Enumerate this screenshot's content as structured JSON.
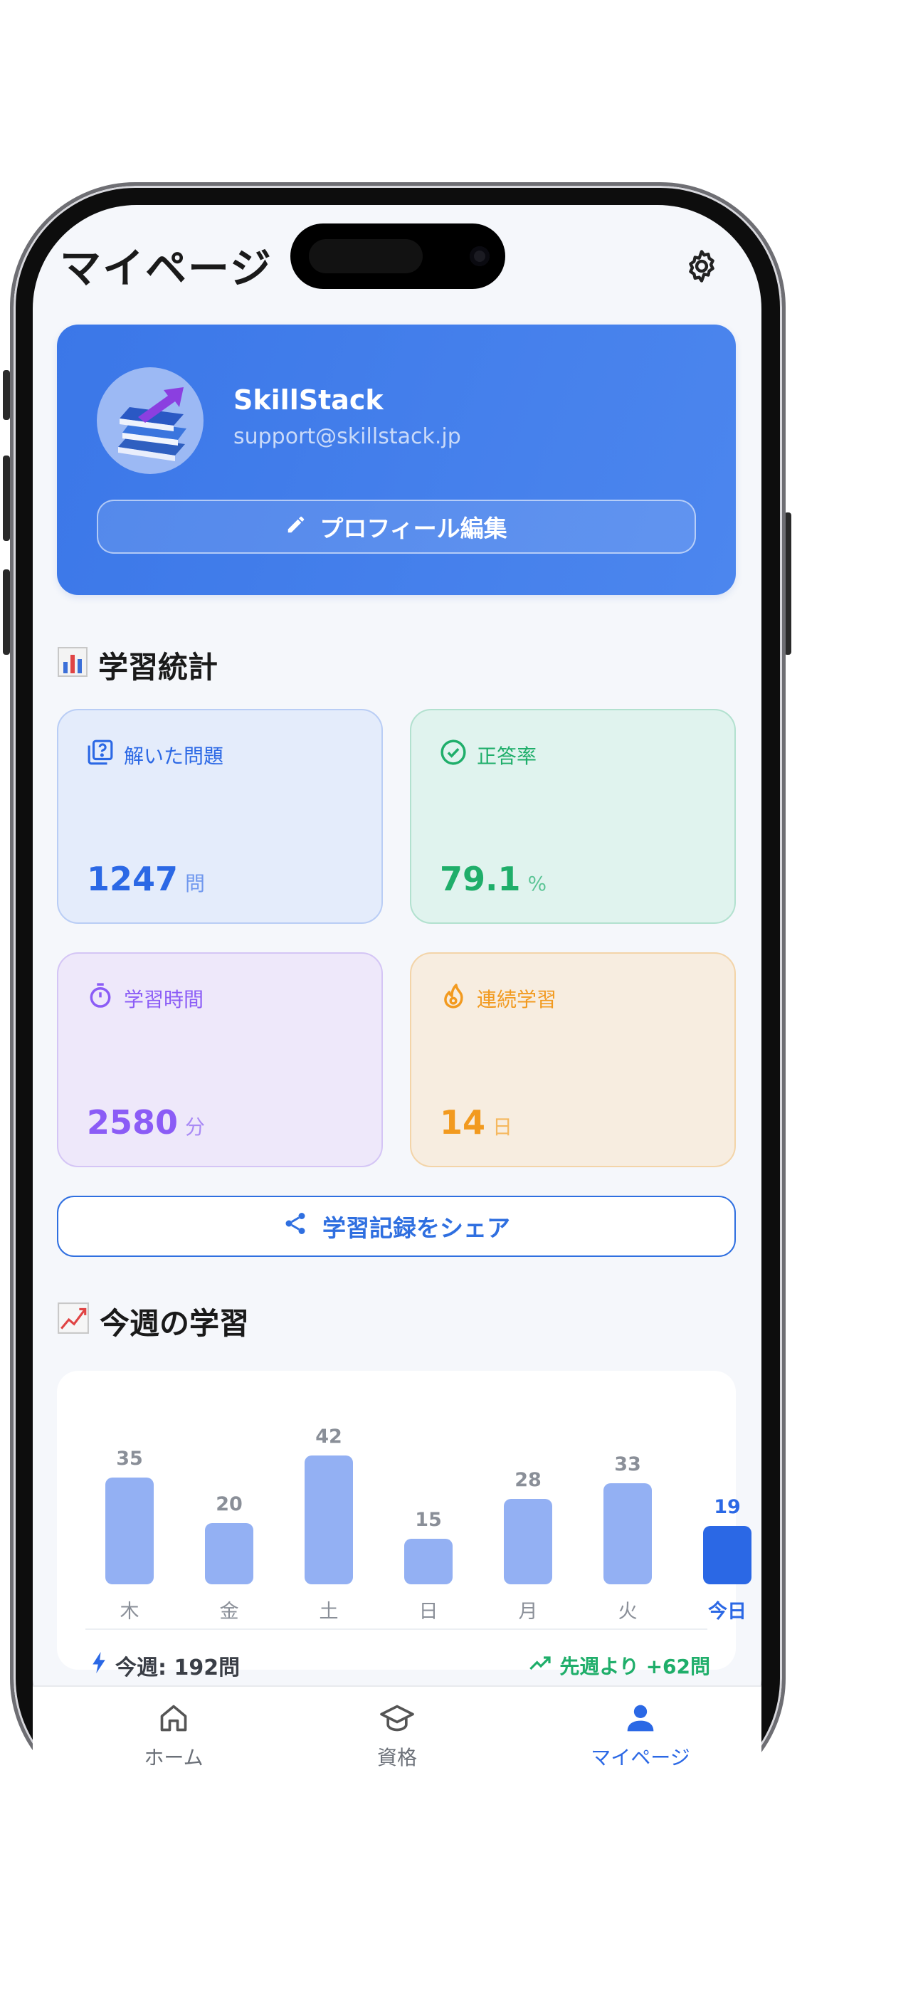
{
  "header": {
    "title": "マイページ"
  },
  "profile": {
    "name": "SkillStack",
    "email": "support@skillstack.jp",
    "edit_label": "プロフィール編集"
  },
  "stats": {
    "section_title": "学習統計",
    "solved": {
      "label": "解いた問題",
      "value": "1247",
      "unit": "問"
    },
    "accuracy": {
      "label": "正答率",
      "value": "79.1",
      "unit": "%"
    },
    "time": {
      "label": "学習時間",
      "value": "2580",
      "unit": "分"
    },
    "streak": {
      "label": "連続学習",
      "value": "14",
      "unit": "日"
    }
  },
  "share": {
    "label": "学習記録をシェア"
  },
  "weekly": {
    "section_title": "今週の学習",
    "summary_left": "今週: 192問",
    "summary_right": "先週より +62問",
    "chart_data": {
      "type": "bar",
      "categories": [
        "木",
        "金",
        "土",
        "日",
        "月",
        "火",
        "今日"
      ],
      "values": [
        35,
        20,
        42,
        15,
        28,
        33,
        19
      ],
      "highlight_index": 6
    }
  },
  "tabs": [
    {
      "label": "ホーム",
      "icon": "home-icon"
    },
    {
      "label": "資格",
      "icon": "graduation-cap-icon"
    },
    {
      "label": "マイページ",
      "icon": "person-icon"
    }
  ],
  "colors": {
    "accent": "#2b68e5",
    "green": "#1fae6a",
    "purple": "#8b5cf6",
    "orange": "#f29a1f"
  }
}
